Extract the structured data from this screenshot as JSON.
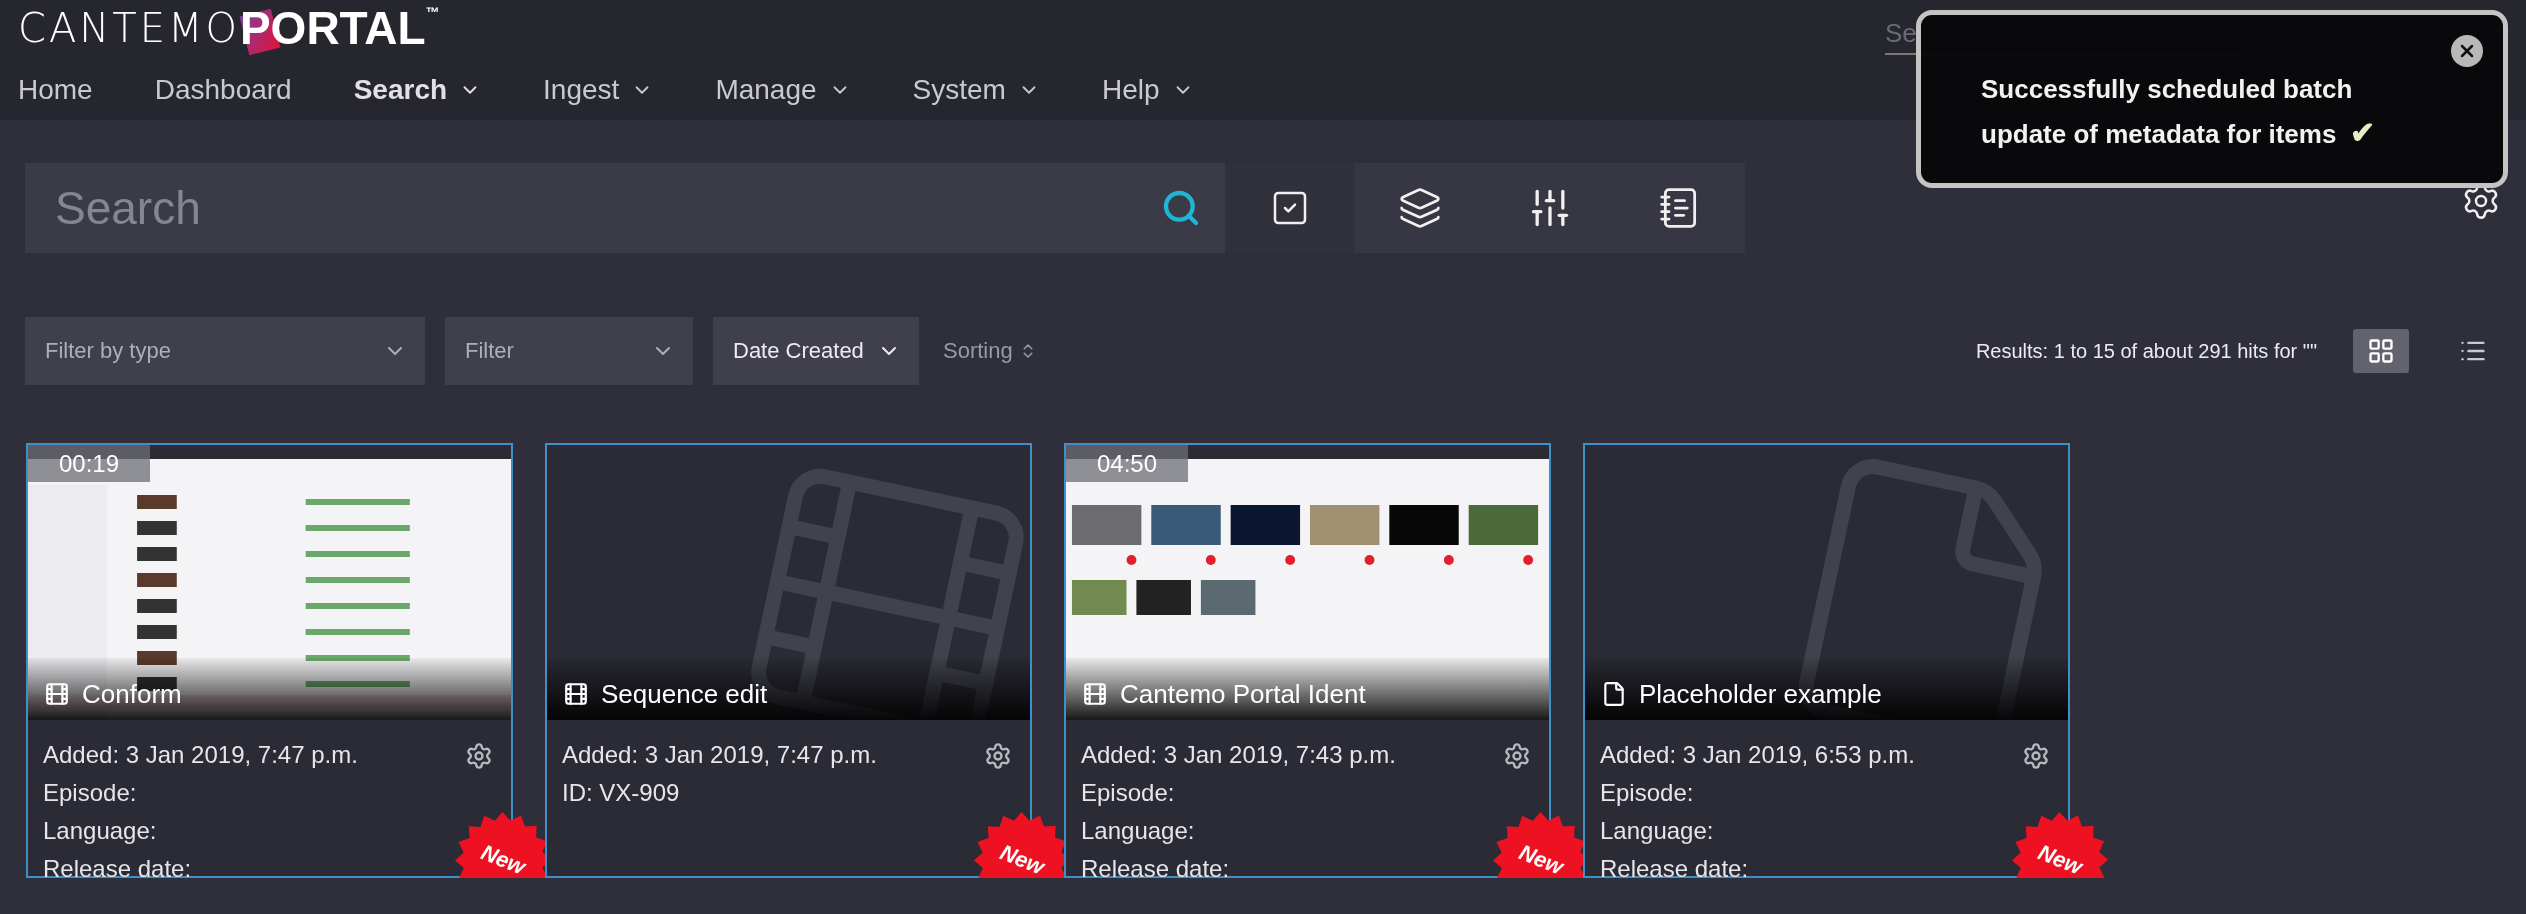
{
  "logo": {
    "light": "CANTEMO",
    "bold": "PORTAL",
    "tm": "™"
  },
  "nav": [
    {
      "label": "Home",
      "selected": false,
      "has_menu": false
    },
    {
      "label": "Dashboard",
      "selected": false,
      "has_menu": false
    },
    {
      "label": "Search",
      "selected": true,
      "has_menu": true
    },
    {
      "label": "Ingest",
      "selected": false,
      "has_menu": true
    },
    {
      "label": "Manage",
      "selected": false,
      "has_menu": true
    },
    {
      "label": "System",
      "selected": false,
      "has_menu": true
    },
    {
      "label": "Help",
      "selected": false,
      "has_menu": true
    }
  ],
  "header_search": {
    "placeholder": "Se"
  },
  "toast": {
    "message": "Successfully scheduled batch update of metadata for items",
    "check": "✔"
  },
  "search": {
    "placeholder": "Search"
  },
  "filters": [
    {
      "placeholder": "Filter by type"
    },
    {
      "placeholder": "Filter"
    },
    {
      "value": "Date Created"
    }
  ],
  "sorting": "Sorting",
  "results": "Results: 1 to 15 of about 291 hits for \"\"",
  "views": [
    {
      "kind": "grid",
      "selected": true
    },
    {
      "kind": "list",
      "selected": false
    }
  ],
  "cards": [
    {
      "kind": "video",
      "title": "Conform",
      "duration": "00:19",
      "meta": [
        "Added: 3 Jan 2019, 7:47 p.m.",
        "Episode:",
        "Language:",
        "Release date:"
      ],
      "badge": "New"
    },
    {
      "kind": "sequence",
      "title": "Sequence edit",
      "meta": [
        "Added: 3 Jan 2019, 7:47 p.m.",
        "ID: VX-909"
      ],
      "badge": "New"
    },
    {
      "kind": "video",
      "title": "Cantemo Portal Ident",
      "duration": "04:50",
      "meta": [
        "Added: 3 Jan 2019, 7:43 p.m.",
        "Episode:",
        "Language:",
        "Release date:"
      ],
      "badge": "New"
    },
    {
      "kind": "placeholder",
      "title": "Placeholder example",
      "meta": [
        "Added: 3 Jan 2019, 6:53 p.m.",
        "Episode:",
        "Language:",
        "Release date:"
      ],
      "badge": "New"
    }
  ]
}
